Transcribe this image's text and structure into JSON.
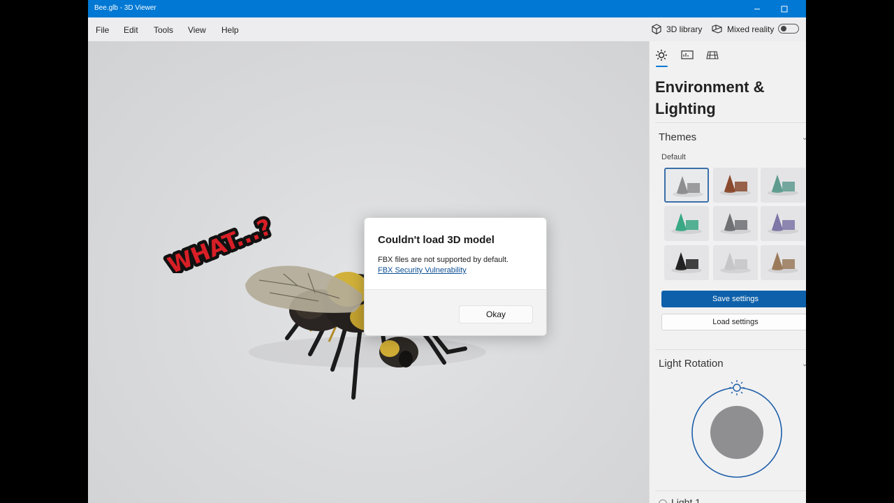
{
  "window": {
    "title": "Bee.glb - 3D Viewer",
    "minimize_icon": "minimize-icon",
    "maximize_icon": "maximize-icon"
  },
  "menu": {
    "items": [
      "File",
      "Edit",
      "Tools",
      "View",
      "Help"
    ],
    "library_label": "3D library",
    "mixed_reality_label": "Mixed reality",
    "mixed_reality_on": false
  },
  "overlay_text": "WHAT...?",
  "panel": {
    "tabs": [
      "sun-icon",
      "stats-icon",
      "grid-icon"
    ],
    "active_tab": 0,
    "title": "Environment & Lighting",
    "themes_section": "Themes",
    "themes_default_label": "Default",
    "themes": [
      {
        "accent": "#8e8e90",
        "selected": true
      },
      {
        "accent": "#8a4a2e",
        "selected": false
      },
      {
        "accent": "#5f9c8f",
        "selected": false
      },
      {
        "accent": "#3aa884",
        "selected": false
      },
      {
        "accent": "#6f7073",
        "selected": false
      },
      {
        "accent": "#7d76a6",
        "selected": false
      },
      {
        "accent": "#222222",
        "selected": false
      },
      {
        "accent": "#c6c6c8",
        "selected": false
      },
      {
        "accent": "#9a7a5a",
        "selected": false
      }
    ],
    "save_settings": "Save settings",
    "load_settings": "Load settings",
    "light_rotation_section": "Light Rotation",
    "light1_label": "Light 1"
  },
  "dialog": {
    "title": "Couldn't load 3D model",
    "message": "FBX files are not supported by default.",
    "link": "FBX Security Vulnerability",
    "button": "Okay"
  },
  "colors": {
    "accent": "#0078d4",
    "primary_button": "#0e60aa",
    "overlay_red": "#d81f26"
  }
}
